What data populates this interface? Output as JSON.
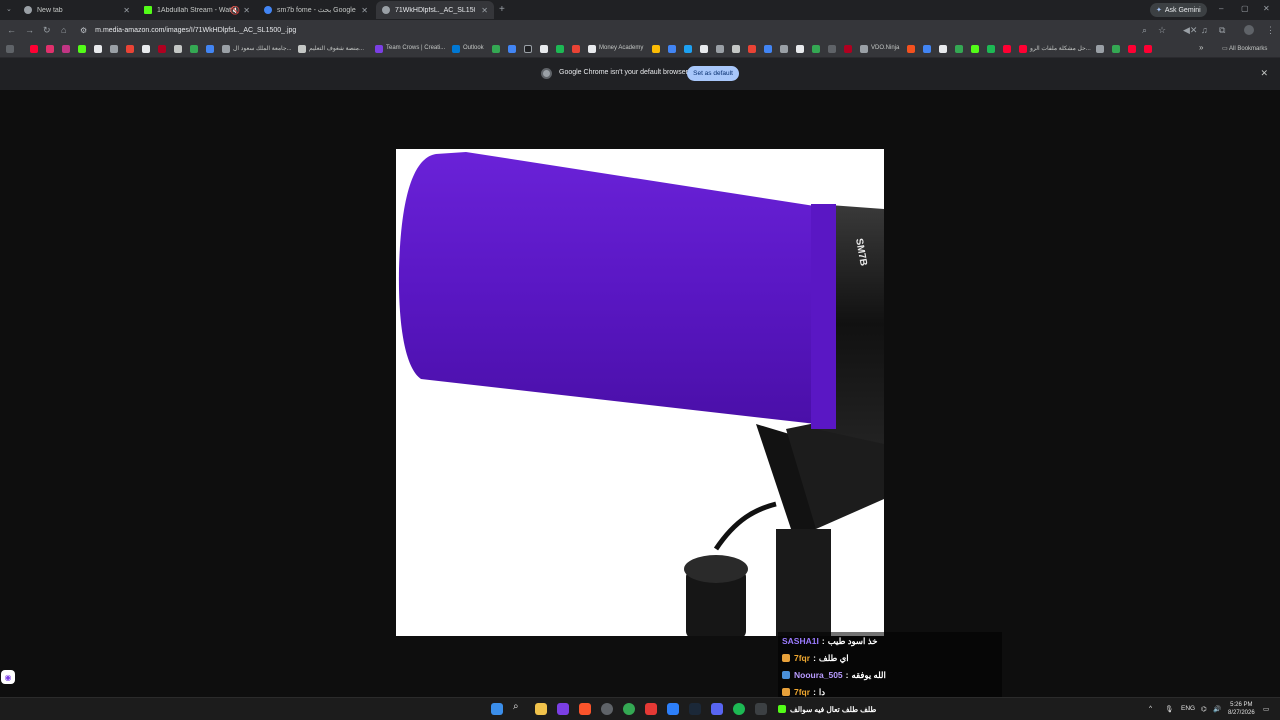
{
  "tabs": [
    {
      "label": "New tab",
      "favicon_color": "#9aa0a6",
      "active": false
    },
    {
      "label": "1‏Abdullah Stream - Watch",
      "favicon_color": "#53fc18",
      "active": false
    },
    {
      "label": "sm7b fome - بحث Google",
      "favicon_color": "#4285f4",
      "active": false
    },
    {
      "label": "71WkHDlpfsL._AC_SL1500_.jpg",
      "favicon_color": "#9aa0a6",
      "active": true
    }
  ],
  "ask_gemini": "Ask Gemini",
  "address": {
    "url": "m.media-amazon.com/images/I/71WkHDlpfsL._AC_SL1500_.jpg"
  },
  "bookmarks": {
    "items": [
      "جامعة الملك سعود ال...",
      "منصة شغوف التعليم...",
      "Team Crows | Creati...",
      "Outlook",
      "Money Academy",
      "VDO.Ninja",
      "حل مشكلة ملفات الرو..."
    ],
    "all_bookmarks": "All Bookmarks"
  },
  "infobar": {
    "message": "Google Chrome isn't your default browser",
    "button": "Set as default"
  },
  "image": {
    "foam_color": "#5a17c4",
    "mic_label": "SM7B"
  },
  "chat": [
    {
      "user": "SASHA1I",
      "user_color": "#9b7bff",
      "message": "خذ اسود طيب",
      "badge": false
    },
    {
      "user": "7fqr",
      "user_color": "#f0a830",
      "message": "اي طلف",
      "badge": true,
      "badge_color": "#e8a13a"
    },
    {
      "user": "Nooura_505",
      "user_color": "#b89bff",
      "message": "الله يوفقه",
      "badge": true,
      "badge_color": "#4a90d9"
    },
    {
      "user": "7fqr",
      "user_color": "#f0a830",
      "message": "دا",
      "badge": true,
      "badge_color": "#e8a13a"
    },
    {
      "user": "",
      "user_color": "#ffffff",
      "message": "طلف طلف تعال فيه سوالف",
      "badge": true,
      "badge_color": "#53fc18"
    }
  ],
  "taskbar": {
    "lang": "ENG",
    "time": "5:26 PM",
    "date": "8/27/2026"
  }
}
